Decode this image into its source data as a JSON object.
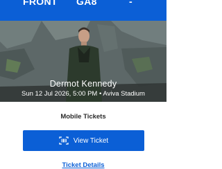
{
  "ticket_header": {
    "section": "FRONT",
    "row": "GA8",
    "seat": "-"
  },
  "event": {
    "artist": "Dermot Kennedy",
    "details": "Sun 12 Jul 2026, 5:00 PM • Aviva Stadium"
  },
  "tickets": {
    "heading": "Mobile Tickets",
    "view_button_label": "View Ticket",
    "details_link": "Ticket Details"
  },
  "icons": {
    "view_ticket": "ticket-barcode-icon"
  },
  "colors": {
    "brand_blue": "#0b5fd6",
    "text_dark": "#2a2a2a"
  }
}
